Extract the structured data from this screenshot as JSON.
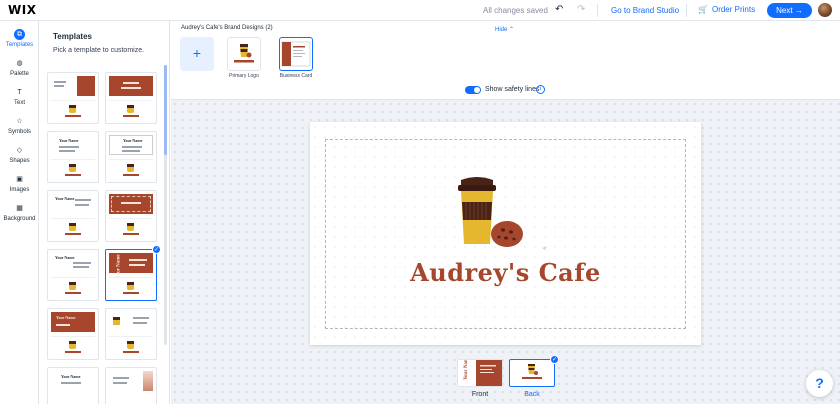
{
  "app": {
    "logo": "WIX"
  },
  "topbar": {
    "saved_status": "All changes saved",
    "undo_icon": "↶",
    "redo_icon": "↷",
    "brand_studio_link": "Go to Brand Studio",
    "order_prints": "Order Prints",
    "next_button": "Next →"
  },
  "rail": {
    "items": [
      {
        "label": "Templates",
        "icon": "⧉",
        "active": true
      },
      {
        "label": "Palette",
        "icon": "◍"
      },
      {
        "label": "Text",
        "icon": "T"
      },
      {
        "label": "Symbols",
        "icon": "☆"
      },
      {
        "label": "Shapes",
        "icon": "◇"
      },
      {
        "label": "Images",
        "icon": "▣"
      },
      {
        "label": "Background",
        "icon": "▦"
      }
    ]
  },
  "templates_panel": {
    "title": "Templates",
    "subtitle": "Pick a template to customize.",
    "name_placeholder": "Your Name"
  },
  "brand_strip": {
    "title": "Audrey's Cafe's Brand Designs (2)",
    "hide_link": "Hide ⌃",
    "add_icon": "+",
    "designs": [
      {
        "caption": "Primary Logo"
      },
      {
        "caption": "Business Card"
      }
    ]
  },
  "canvas": {
    "safety_label": "Show safety lines",
    "info_icon": "i",
    "cafe_name": "Audrey's Cafe"
  },
  "pages": [
    {
      "label": "Front",
      "selected": false
    },
    {
      "label": "Back",
      "selected": true
    }
  ],
  "help_button": "?",
  "colors": {
    "accent": "#116dff",
    "brand_brown": "#a6472d",
    "cup_yellow": "#e5b72e",
    "lid_dark": "#4a2317"
  }
}
